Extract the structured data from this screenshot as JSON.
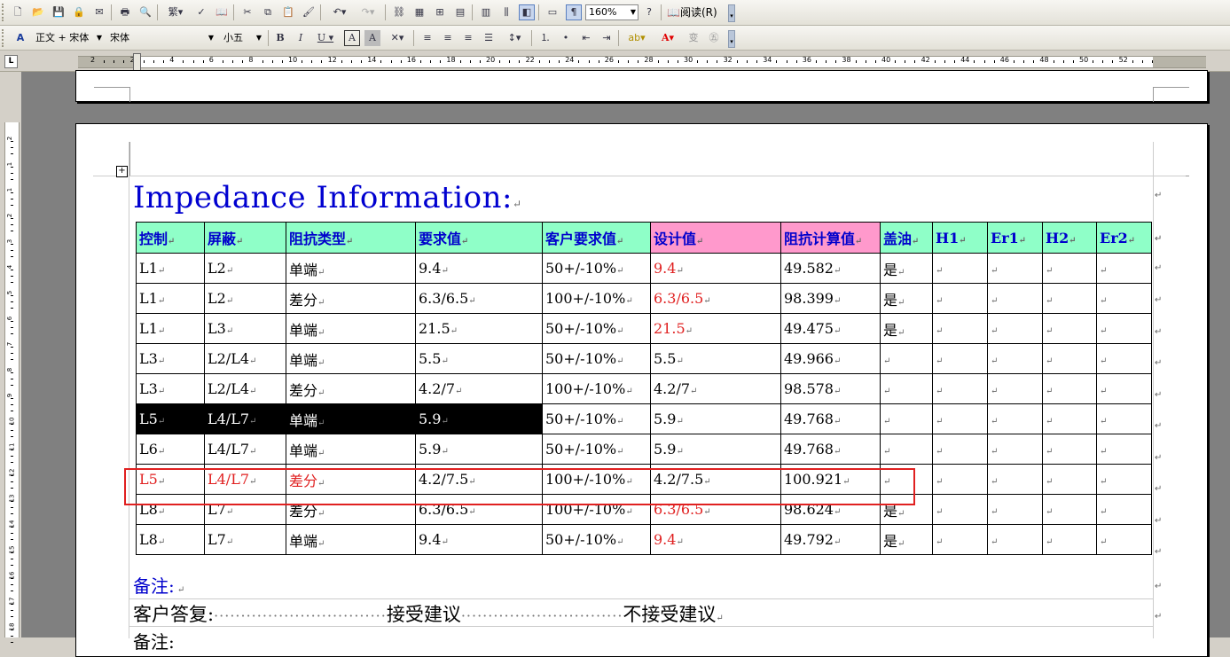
{
  "toolbar1": {
    "zoom": "160%",
    "read_label": "阅读",
    "read_key": "(R)"
  },
  "toolbar2": {
    "style": "正文 + 宋体",
    "font": "宋体",
    "size": "小五"
  },
  "ruler_numbers": [
    "2",
    "2",
    "4",
    "6",
    "8",
    "10",
    "12",
    "14",
    "16",
    "18",
    "20",
    "22",
    "24",
    "26",
    "28",
    "30",
    "32",
    "34",
    "36",
    "38",
    "40",
    "42",
    "44",
    "46",
    "48",
    "50",
    "52"
  ],
  "vruler_numbers": [
    "2",
    "1",
    "1",
    "2",
    "3",
    "4",
    "5",
    "6",
    "7",
    "8",
    "9",
    "10",
    "11",
    "12",
    "13",
    "14",
    "15",
    "16",
    "17",
    "18"
  ],
  "document": {
    "title": "Impedance Information:",
    "headers": [
      "控制",
      "屏蔽",
      "阻抗类型",
      "要求值",
      "客户要求值",
      "设计值",
      "阻抗计算值",
      "盖油",
      "H1",
      "Er1",
      "H2",
      "Er2"
    ],
    "rows": [
      [
        "L1",
        "L2",
        "单端",
        "9.4",
        "50+/-10%",
        "9.4",
        "49.582",
        "是",
        "",
        "",
        "",
        ""
      ],
      [
        "L1",
        "L2",
        "差分",
        "6.3/6.5",
        "100+/-10%",
        "6.3/6.5",
        "98.399",
        "是",
        "",
        "",
        "",
        ""
      ],
      [
        "L1",
        "L3",
        "单端",
        "21.5",
        "50+/-10%",
        "21.5",
        "49.475",
        "是",
        "",
        "",
        "",
        ""
      ],
      [
        "L3",
        "L2/L4",
        "单端",
        "5.5",
        "50+/-10%",
        "5.5",
        "49.966",
        "",
        "",
        "",
        "",
        ""
      ],
      [
        "L3",
        "L2/L4",
        "差分",
        "4.2/7",
        "100+/-10%",
        "4.2/7",
        "98.578",
        "",
        "",
        "",
        "",
        ""
      ],
      [
        "L5",
        "L4/L7",
        "单端",
        "5.9",
        "50+/-10%",
        "5.9",
        "49.768",
        "",
        "",
        "",
        "",
        ""
      ],
      [
        "L6",
        "L4/L7",
        "单端",
        "5.9",
        "50+/-10%",
        "5.9",
        "49.768",
        "",
        "",
        "",
        "",
        ""
      ],
      [
        "L5",
        "L4/L7",
        "差分",
        "4.2/7.5",
        "100+/-10%",
        "4.2/7.5",
        "100.921",
        "",
        "",
        "",
        "",
        ""
      ],
      [
        "L8",
        "L7",
        "差分",
        "6.3/6.5",
        "100+/-10%",
        "6.3/6.5",
        "98.624",
        "是",
        "",
        "",
        "",
        ""
      ],
      [
        "L8",
        "L7",
        "单端",
        "9.4",
        "50+/-10%",
        "9.4",
        "49.792",
        "是",
        "",
        "",
        "",
        ""
      ]
    ],
    "remark_label": "备注:",
    "reply_label": "客户答复:",
    "accept": "接受建议",
    "reject": "不接受建议",
    "remark2_label": "备注:"
  },
  "colors": {
    "header_bg": "#8fffc8",
    "header_pink": "#ff99cc",
    "title_blue": "#0000d0",
    "red_text": "#e02020",
    "highlight_border": "#e02020"
  }
}
